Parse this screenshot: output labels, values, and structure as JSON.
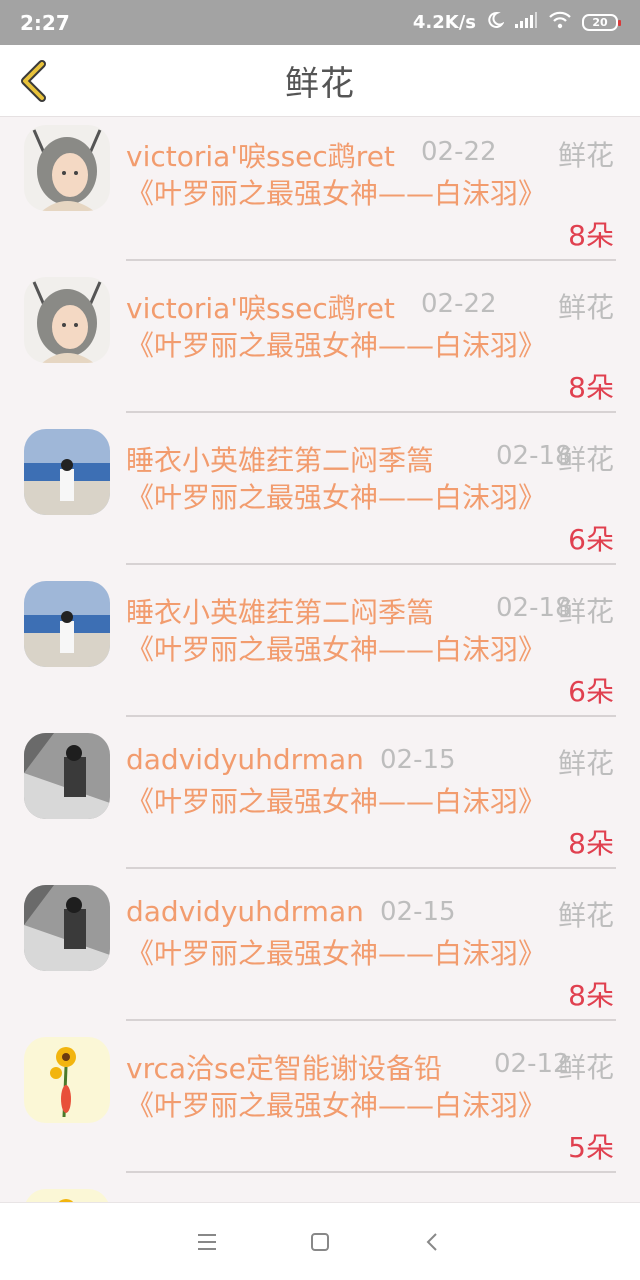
{
  "status_bar": {
    "time": "2:27",
    "network_speed": "4.2K/s",
    "battery": "20"
  },
  "header": {
    "title": "鲜花",
    "back_icon": "chevron-left-icon",
    "accent": "#e8c23a"
  },
  "colors": {
    "name": "#f29c6e",
    "count": "#e0404f",
    "muted": "#bdbdbd"
  },
  "records": [
    {
      "name": "victoria'唳ssec鹉ret",
      "date": "02-22",
      "type": "鲜花",
      "book": "《叶罗丽之最强女神——白沫羽》",
      "count": "8朵",
      "avatar": "girl-illustration"
    },
    {
      "name": "victoria'唳ssec鹉ret",
      "date": "02-22",
      "type": "鲜花",
      "book": "《叶罗丽之最强女神——白沫羽》",
      "count": "8朵",
      "avatar": "girl-illustration"
    },
    {
      "name": "睡衣小英雄荭第二闷季篙",
      "date": "02-18",
      "type": "鲜花",
      "book": "《叶罗丽之最强女神——白沫羽》",
      "count": "6朵",
      "avatar": "beach-photo"
    },
    {
      "name": "睡衣小英雄荭第二闷季篙",
      "date": "02-18",
      "type": "鲜花",
      "book": "《叶罗丽之最强女神——白沫羽》",
      "count": "6朵",
      "avatar": "beach-photo"
    },
    {
      "name": "dadvidyuhdrman",
      "date": "02-15",
      "type": "鲜花",
      "book": "《叶罗丽之最强女神——白沫羽》",
      "count": "8朵",
      "avatar": "bw-photo"
    },
    {
      "name": "dadvidyuhdrman",
      "date": "02-15",
      "type": "鲜花",
      "book": "《叶罗丽之最强女神——白沫羽》",
      "count": "8朵",
      "avatar": "bw-photo"
    },
    {
      "name": "vrca洽se定智能谢设备铅",
      "date": "02-12",
      "type": "鲜花",
      "book": "《叶罗丽之最强女神——白沫羽》",
      "count": "5朵",
      "avatar": "sunflower"
    },
    {
      "name": "",
      "date": "",
      "type": "",
      "book": "",
      "count": "",
      "avatar": "sunflower"
    }
  ],
  "system_nav": {
    "menu_icon": "menu-icon",
    "home_icon": "home-square-icon",
    "back_icon": "back-chevron-icon"
  }
}
